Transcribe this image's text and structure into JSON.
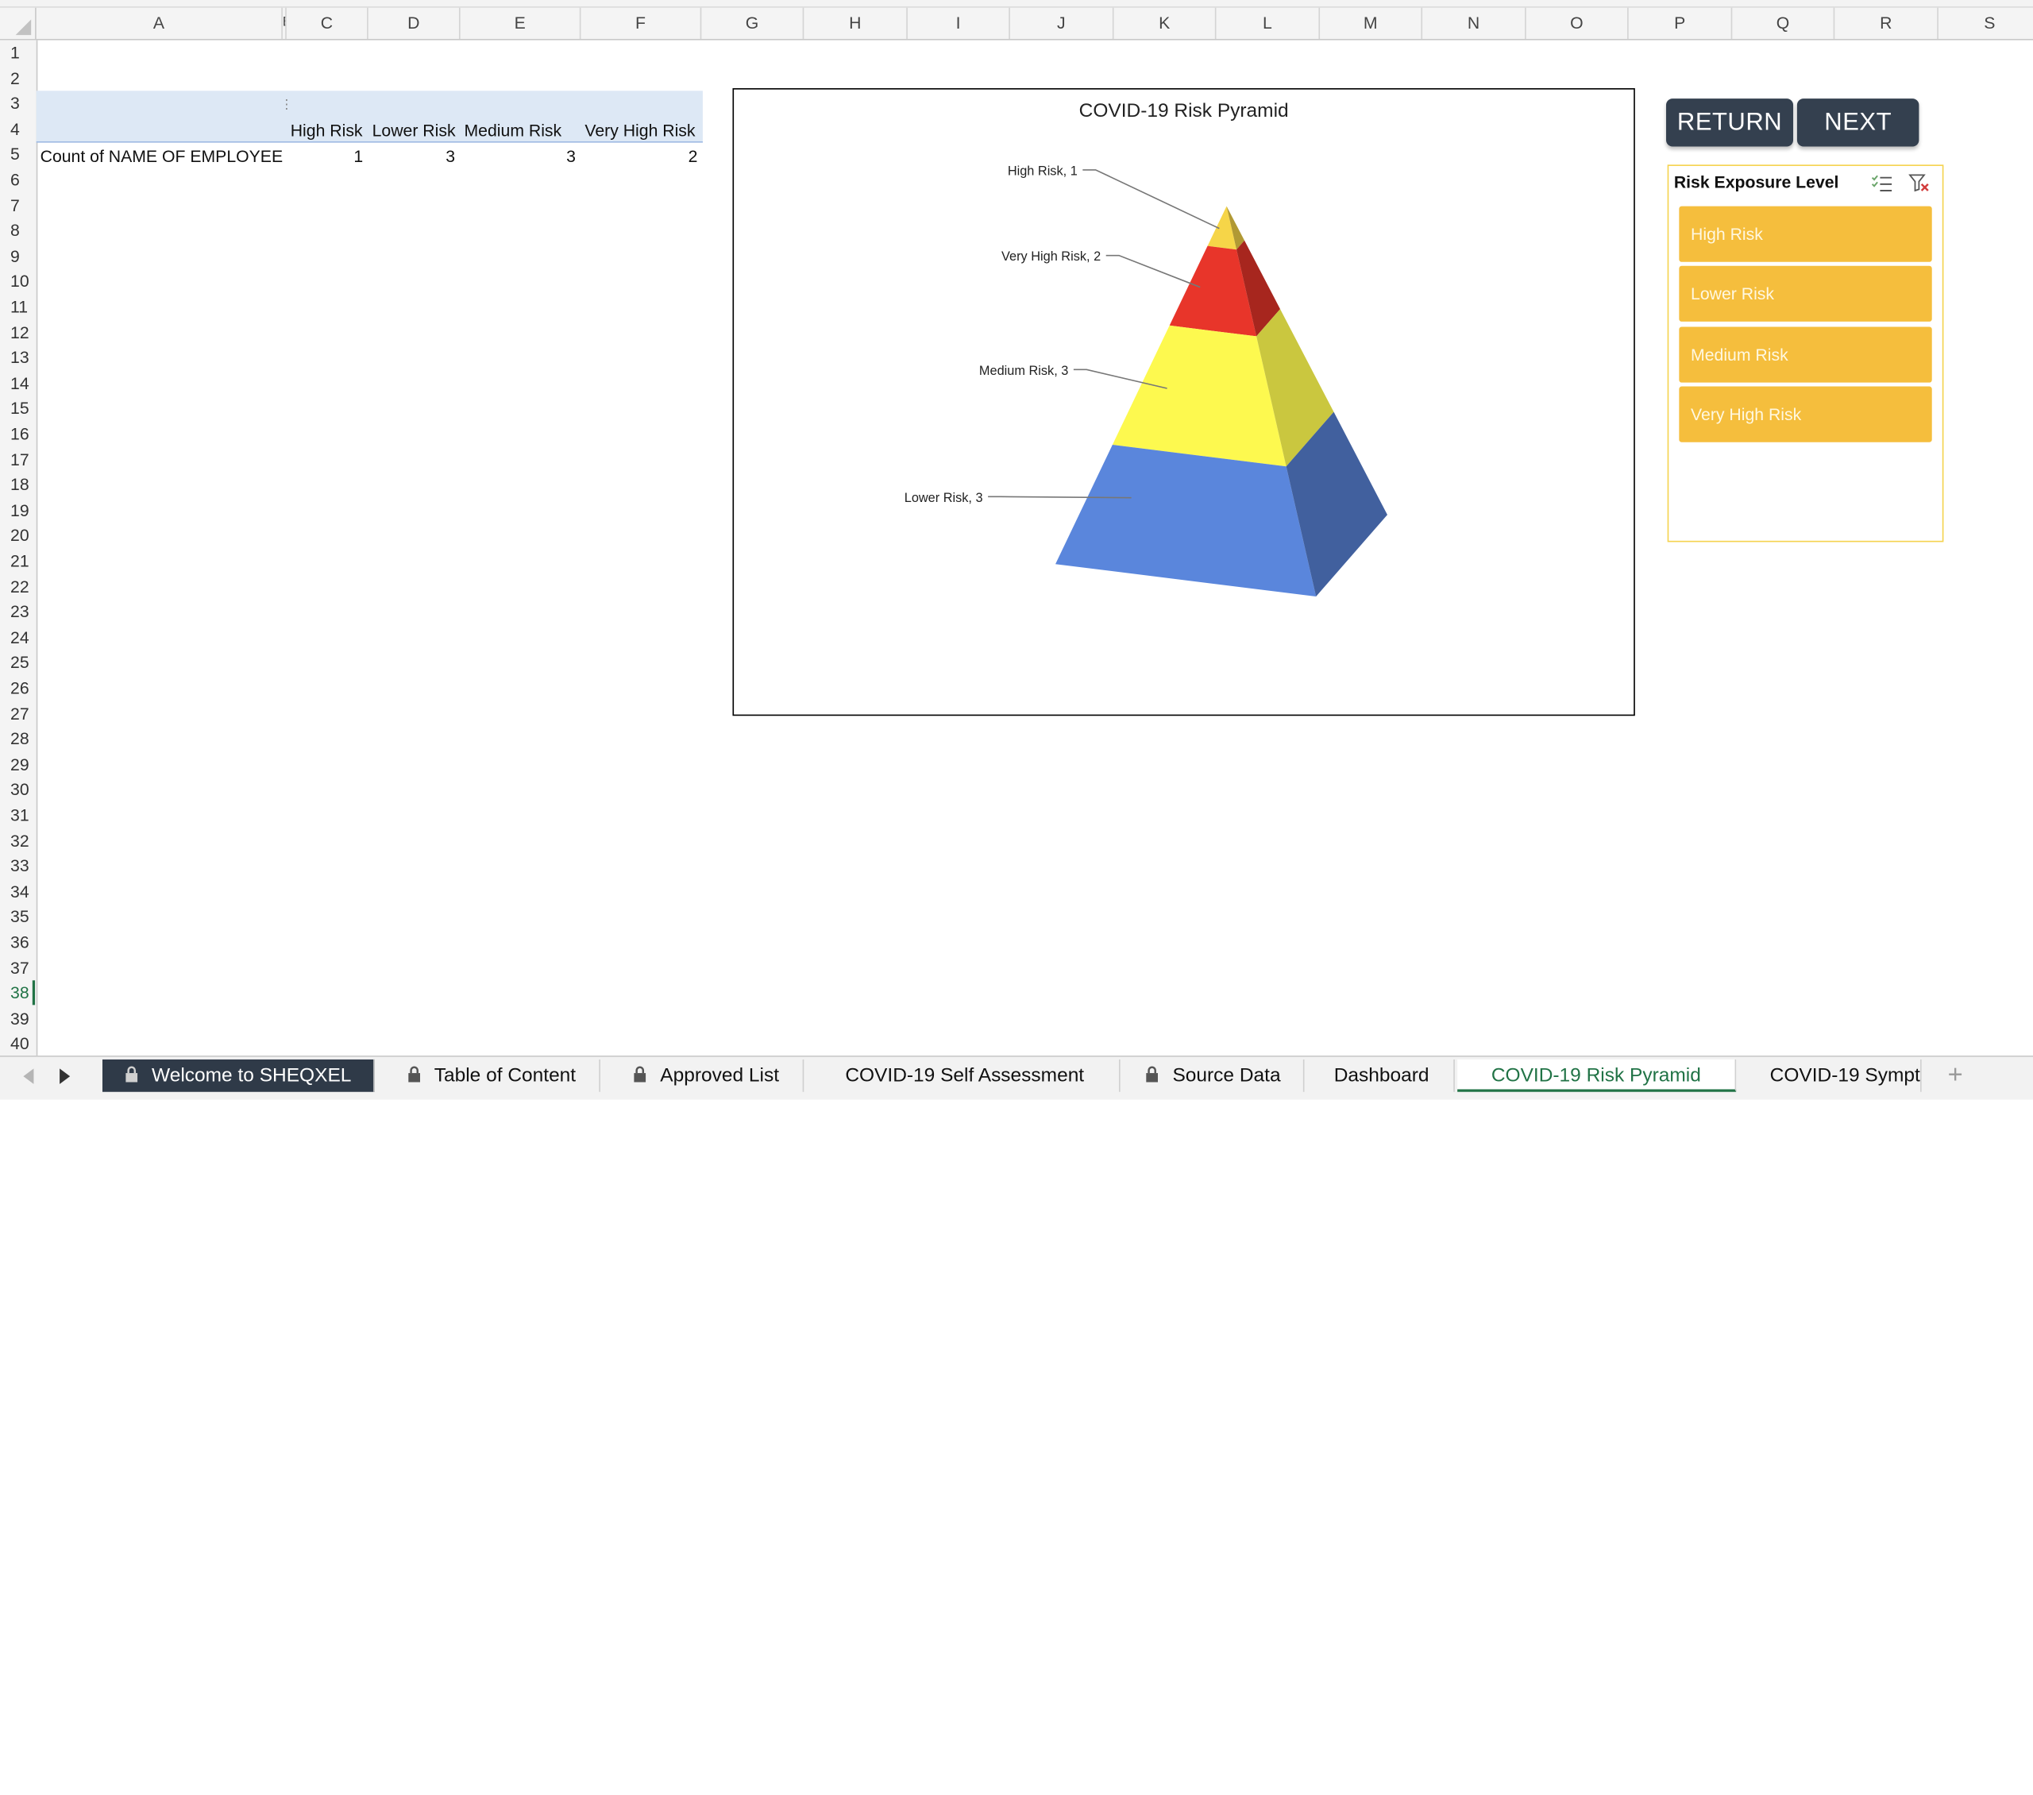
{
  "columns": [
    "A",
    "B",
    "C",
    "D",
    "E",
    "F",
    "G",
    "H",
    "I",
    "J",
    "K",
    "L",
    "M",
    "N",
    "O",
    "P",
    "Q",
    "R",
    "S"
  ],
  "rows": [
    "1",
    "2",
    "3",
    "4",
    "5",
    "6",
    "7",
    "8",
    "9",
    "10",
    "11",
    "12",
    "13",
    "14",
    "15",
    "16",
    "17",
    "18",
    "19",
    "20",
    "21",
    "22",
    "23",
    "24",
    "25",
    "26",
    "27",
    "28",
    "29",
    "30",
    "31",
    "32",
    "33",
    "34",
    "35",
    "36",
    "37",
    "38",
    "39",
    "40"
  ],
  "selected_row": "38",
  "pivot": {
    "col_headers": [
      "High Risk",
      "Lower Risk",
      "Medium Risk",
      "Very High Risk"
    ],
    "row_label": "Count of NAME OF EMPLOYEE",
    "values": [
      "1",
      "3",
      "3",
      "2"
    ]
  },
  "buttons": {
    "return_label": "RETURN",
    "next_label": "NEXT"
  },
  "slicer": {
    "title": "Risk Exposure Level",
    "items": [
      "High Risk",
      "Lower Risk",
      "Medium Risk",
      "Very High Risk"
    ]
  },
  "chart_data": {
    "type": "pyramid",
    "title": "COVID-19 Risk Pyramid",
    "categories": [
      "High Risk",
      "Very High Risk",
      "Medium Risk",
      "Lower Risk"
    ],
    "values": [
      1,
      2,
      3,
      3
    ],
    "data_labels": [
      "High Risk, 1",
      "Very High Risk, 2",
      "Medium Risk, 3",
      "Lower Risk, 3"
    ],
    "colors": [
      "#f6d548",
      "#e8352a",
      "#fdf94f",
      "#5a86dc"
    ],
    "legend": "none"
  },
  "tabs": [
    {
      "label": "Welcome to SHEQXEL",
      "locked": true
    },
    {
      "label": "Table of Content",
      "locked": true
    },
    {
      "label": "Approved List",
      "locked": true
    },
    {
      "label": "COVID-19 Self Assessment",
      "locked": false
    },
    {
      "label": "Source Data",
      "locked": true
    },
    {
      "label": "Dashboard",
      "locked": false
    },
    {
      "label": "COVID-19 Risk Pyramid",
      "locked": false
    },
    {
      "label": "COVID-19 Sympt",
      "locked": false
    }
  ],
  "active_tab": "COVID-19 Risk Pyramid"
}
